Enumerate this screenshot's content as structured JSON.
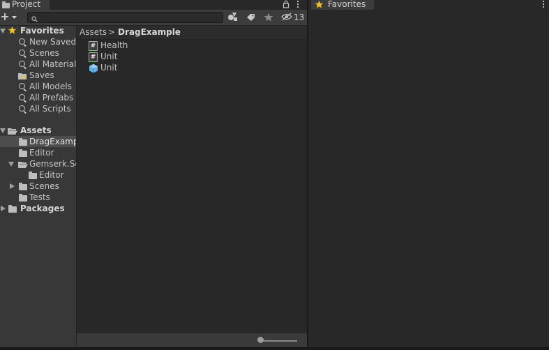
{
  "project_tab": {
    "label": "Project"
  },
  "favorites_tab": {
    "label": "Favorites"
  },
  "toolbar": {
    "add_label": "+",
    "search_placeholder": "",
    "hidden_count": "13"
  },
  "tree": {
    "favorites": {
      "label": "Favorites",
      "items": [
        "New Saved",
        "Scenes",
        "All Materials",
        "Saves",
        "All Models",
        "All Prefabs",
        "All Scripts"
      ]
    },
    "assets": {
      "label": "Assets",
      "items": [
        "DragExample",
        "Editor",
        "Gemserk.Se",
        "Editor",
        "Scenes",
        "Tests"
      ]
    },
    "packages": {
      "label": "Packages"
    }
  },
  "breadcrumb": {
    "root": "Assets",
    "separator": ">",
    "current": "DragExample"
  },
  "files": [
    {
      "name": "Health",
      "icon": "csharp-script-icon"
    },
    {
      "name": "Unit",
      "icon": "csharp-script-icon"
    },
    {
      "name": "Unit",
      "icon": "prefab-icon"
    }
  ],
  "colors": {
    "accent_star": "#f4c020",
    "prefab_blue": "#5fb3e6",
    "script_green": "#86c486"
  }
}
